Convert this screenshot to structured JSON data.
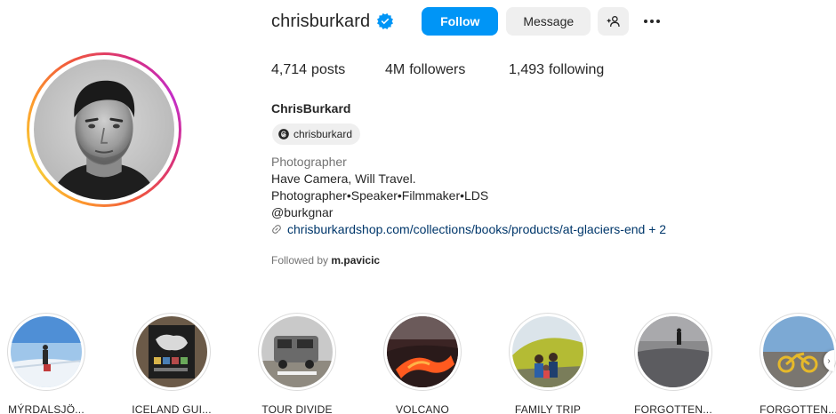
{
  "profile": {
    "username": "chrisburkard",
    "full_name": "ChrisBurkard",
    "threads_handle": "chrisburkard",
    "category": "Photographer",
    "bio_lines": [
      "Have Camera, Will Travel.",
      "Photographer•Speaker•Filmmaker•LDS",
      "@burkgnar"
    ],
    "link": "chrisburkardshop.com/collections/books/products/at-glaciers-end + 2",
    "followed_by_prefix": "Followed by",
    "followed_by_user": "m.pavicic"
  },
  "actions": {
    "follow_label": "Follow",
    "message_label": "Message",
    "add_user_icon": "add-person-icon",
    "more_icon": "more-dots-icon"
  },
  "stats": {
    "posts_count": "4,714",
    "posts_label": "posts",
    "followers_count": "4M",
    "followers_label": "followers",
    "following_count": "1,493",
    "following_label": "following"
  },
  "highlights": [
    {
      "label": "MÝRDALSJÖ..."
    },
    {
      "label": "ICELAND GUI..."
    },
    {
      "label": "TOUR DIVIDE"
    },
    {
      "label": "VOLCANO"
    },
    {
      "label": "FAMILY TRIP"
    },
    {
      "label": "FORGOTTEN..."
    },
    {
      "label": "FORGOTTEN..."
    }
  ],
  "colors": {
    "follow_button": "#0095f6",
    "secondary_button": "#efefef",
    "verified_badge": "#0095f6",
    "link_text": "#00376b"
  }
}
